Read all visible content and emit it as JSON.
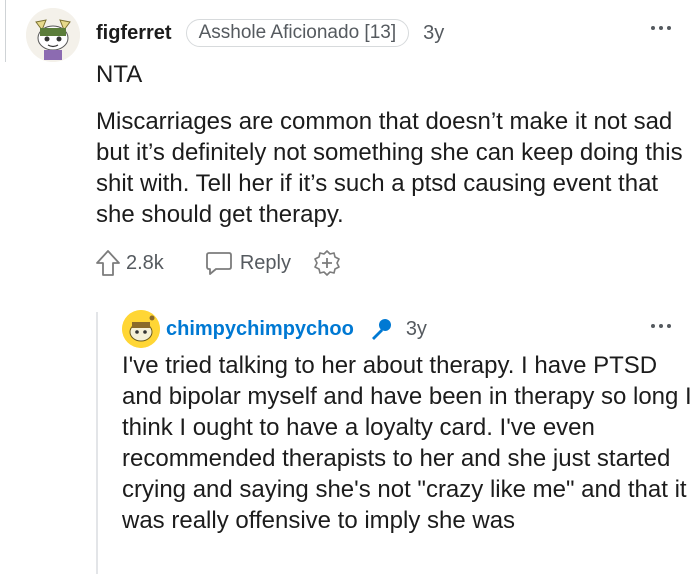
{
  "comment": {
    "username": "figferret",
    "flair": "Asshole Aficionado [13]",
    "time": "3y",
    "verdict": "NTA",
    "body": "Miscarriages are common that doesn’t make it not sad but it’s definitely not something she can keep doing this shit with. Tell her if it’s such a ptsd causing event that she should get therapy.",
    "score": "2.8k",
    "reply_label": "Reply"
  },
  "reply": {
    "username": "chimpychimpychoo",
    "time": "3y",
    "body": "I've tried talking to her about therapy. I have PTSD and bipolar myself and have been in therapy so long I think I ought to have a loyalty card. I've even recommended therapists to her and she just started crying and saying she's not \"crazy like me\" and that it was really offensive to imply she was"
  },
  "colors": {
    "username_op": "#1c1c1c",
    "username_reply": "#0079d3",
    "meta_text": "#555a5f",
    "accent_blue": "#0079d3"
  },
  "icons": {
    "upvote": "upvote-arrow-icon",
    "reply": "speech-bubble-icon",
    "award": "award-plus-icon",
    "more": "more-options-icon",
    "mic": "microphone-icon"
  }
}
